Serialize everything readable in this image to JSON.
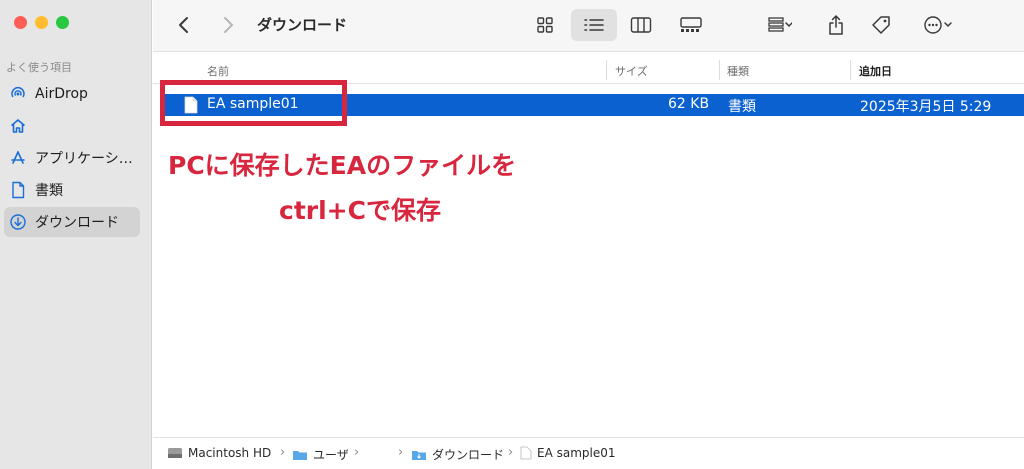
{
  "window": {
    "title": "ダウンロード",
    "traffic_lights": {
      "close": "#fd5f57",
      "minimize": "#febc2e",
      "zoom": "#28c840"
    }
  },
  "sidebar": {
    "section_label": "よく使う項目",
    "items": [
      {
        "label": "AirDrop",
        "icon": "airdrop-icon",
        "active": false
      },
      {
        "label": "",
        "icon": "home-icon",
        "active": false
      },
      {
        "label": "アプリケーシ…",
        "icon": "applications-icon",
        "active": false
      },
      {
        "label": "書類",
        "icon": "document-icon",
        "active": false
      },
      {
        "label": "ダウンロード",
        "icon": "download-icon",
        "active": true
      }
    ]
  },
  "toolbar": {
    "buttons": [
      "back-icon",
      "forward-icon",
      "icon-view-icon",
      "list-view-icon",
      "column-view-icon",
      "gallery-view-icon",
      "group-icon",
      "share-icon",
      "tag-icon",
      "more-icon"
    ]
  },
  "columns": {
    "name": "名前",
    "size": "サイズ",
    "kind": "種類",
    "date": "追加日"
  },
  "files": [
    {
      "name": "EA sample01",
      "size": "62 KB",
      "kind": "書類",
      "date": "2025年3月5日 5:29",
      "selected": true
    }
  ],
  "annotation": {
    "line1": "PCに保存したEAのファイルを",
    "line2": "ctrl+Cで保存",
    "color": "#d7263d"
  },
  "pathbar": {
    "crumbs": [
      "Macintosh HD",
      "ユーザ",
      "ダウンロード",
      "EA sample01"
    ]
  },
  "colors": {
    "selection": "#0a61cf",
    "sidebar_bg": "#e6e6e6"
  }
}
